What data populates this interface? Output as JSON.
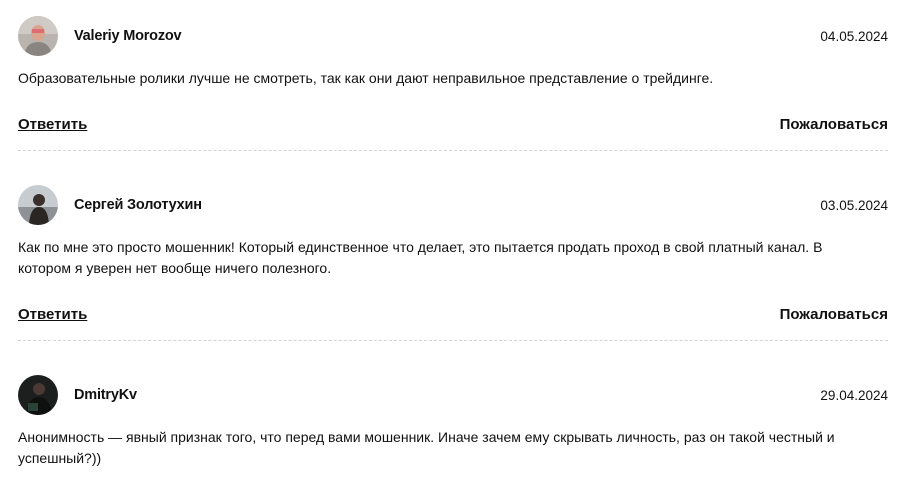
{
  "comments": [
    {
      "author": "Valeriy Morozov",
      "date": "04.05.2024",
      "text": "Образовательные ролики лучше не смотреть, так как они дают неправильное представление о трейдинге.",
      "reply_label": "Ответить",
      "report_label": "Пожаловаться"
    },
    {
      "author": "Сергей Золотухин",
      "date": "03.05.2024",
      "text": "Как по мне это просто мошенник! Который единственное что делает, это пытается продать проход в свой платный канал. В котором я уверен нет вообще ничего полезного.",
      "reply_label": "Ответить",
      "report_label": "Пожаловаться"
    },
    {
      "author": "DmitryKv",
      "date": "29.04.2024",
      "text": "Анонимность — явный признак того, что перед вами мошенник. Иначе зачем ему скрывать личность, раз он такой честный и успешный?))"
    }
  ]
}
